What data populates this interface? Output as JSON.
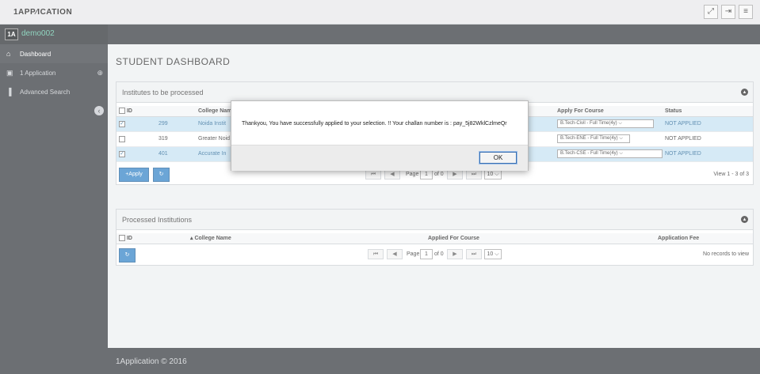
{
  "app": {
    "logo": "1APP⁄ICATION",
    "top_buttons": [
      "expand-icon",
      "signout-icon",
      "menu-icon"
    ]
  },
  "sidebar": {
    "avatar": "1A",
    "username": "demo002",
    "items": [
      {
        "label": "Dashboard",
        "icon": "home-icon",
        "active": true
      },
      {
        "label": "1 Application",
        "icon": "cube-icon"
      },
      {
        "label": "Advanced Search",
        "icon": "bar-chart-icon"
      }
    ]
  },
  "page": {
    "title": "STUDENT DASHBOARD"
  },
  "pending": {
    "title": "Institutes to be processed",
    "columns": [
      "ID",
      "College Name",
      "Apply For Course",
      "Status"
    ],
    "rows": [
      {
        "selected": true,
        "id": "299",
        "college": "Noida Instit",
        "course": "B.Tech-Civil - Full Time(4y)",
        "status": "NOT APPLIED"
      },
      {
        "selected": false,
        "id": "319",
        "college": "Greater Noid",
        "course": "B.Tech-ENE - Full Time(4y)",
        "status": "NOT APPLIED"
      },
      {
        "selected": true,
        "id": "401",
        "college": "Accurate In",
        "course": "B.Tech-CSE - Full Time(4y)",
        "status": "NOT APPLIED"
      }
    ],
    "apply_label": "+Apply",
    "page_label": "Page",
    "page_value": "1",
    "of_label": "of 0",
    "page_size": "10",
    "view_info": "View 1 - 3 of 3"
  },
  "processed": {
    "title": "Processed Institutions",
    "columns": [
      "ID",
      "College Name",
      "Applied For Course",
      "Application Fee"
    ],
    "page_label": "Page",
    "page_value": "1",
    "of_label": "of 0",
    "page_size": "10",
    "empty_text": "No records to view"
  },
  "footer": {
    "text": "1Application © 2016"
  },
  "dialog": {
    "message": "Thankyou, You have successfully applied to your selection. !! Your challan number is : pay_5j82WklCzlmeQr",
    "ok_label": "OK"
  }
}
